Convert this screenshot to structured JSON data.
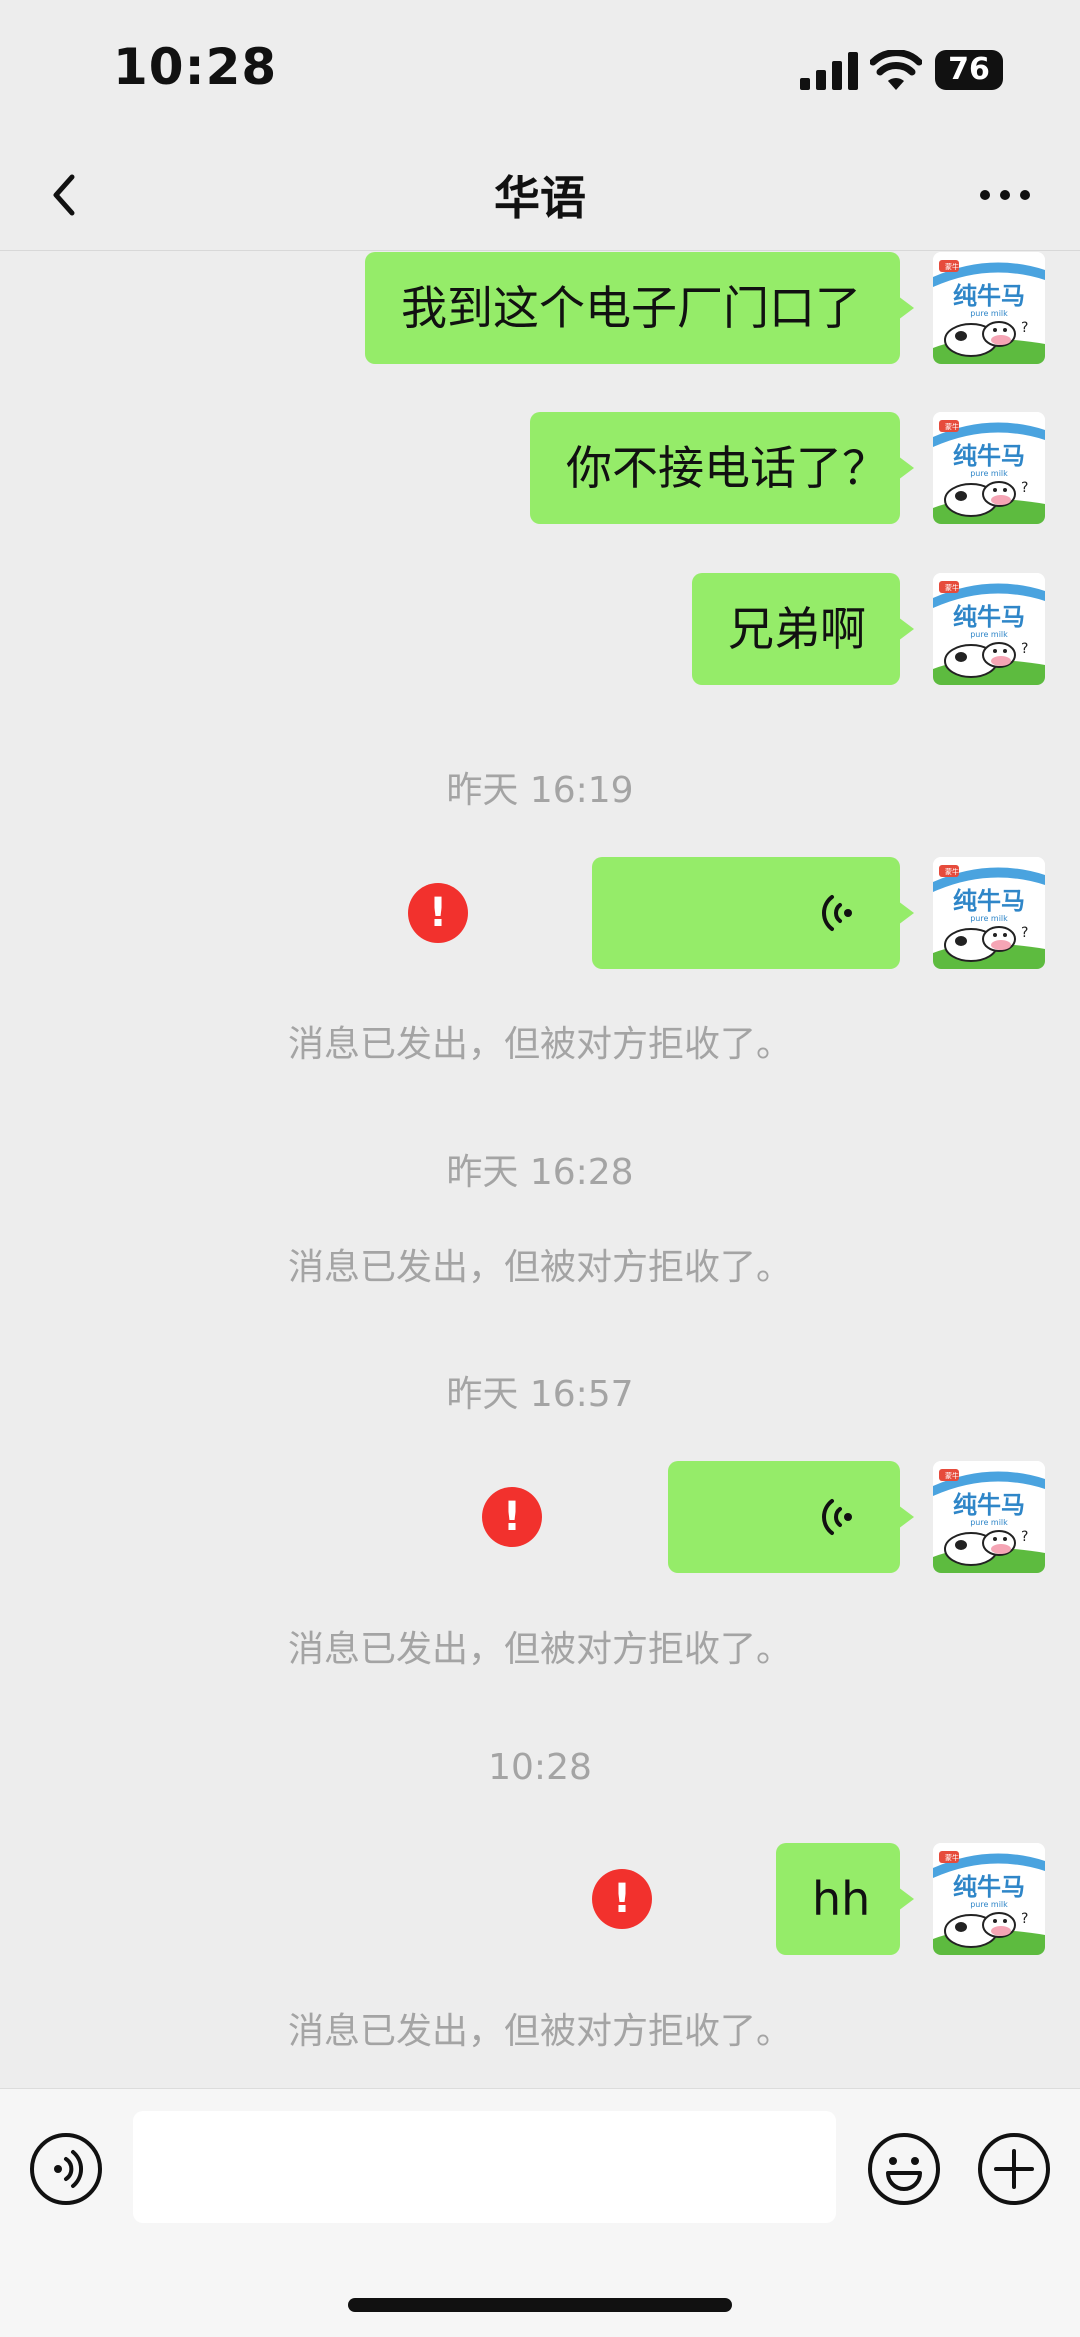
{
  "status_bar": {
    "time": "10:28",
    "battery": "76"
  },
  "nav": {
    "title": "华语"
  },
  "messages": [
    {
      "type": "text",
      "text": "我到这个电子厂门口了"
    },
    {
      "type": "text",
      "text": "你不接电话了？"
    },
    {
      "type": "text",
      "text": "兄弟啊"
    },
    {
      "type": "timestamp",
      "text": "昨天 16:19"
    },
    {
      "type": "voice",
      "failed": true
    },
    {
      "type": "system",
      "text": "消息已发出，但被对方拒收了。"
    },
    {
      "type": "timestamp",
      "text": "昨天 16:28"
    },
    {
      "type": "system",
      "text": "消息已发出，但被对方拒收了。"
    },
    {
      "type": "timestamp",
      "text": "昨天 16:57"
    },
    {
      "type": "voice",
      "failed": true
    },
    {
      "type": "system",
      "text": "消息已发出，但被对方拒收了。"
    },
    {
      "type": "timestamp",
      "text": "10:28"
    },
    {
      "type": "text",
      "text": "hh",
      "failed": true
    },
    {
      "type": "system",
      "text": "消息已发出，但被对方拒收了。"
    }
  ],
  "avatar": {
    "text": "纯牛马",
    "subtext": "pure milk",
    "badge": "蒙牛"
  },
  "error_mark": "!",
  "colors": {
    "bubble": "#95ec69",
    "background": "#ededed",
    "error": "#f2312d",
    "meta_text": "#a4a4a4"
  },
  "icons": [
    "back-icon",
    "more-icon",
    "voice-icon",
    "error-icon",
    "voice-toggle-icon",
    "emoji-icon",
    "plus-icon"
  ]
}
